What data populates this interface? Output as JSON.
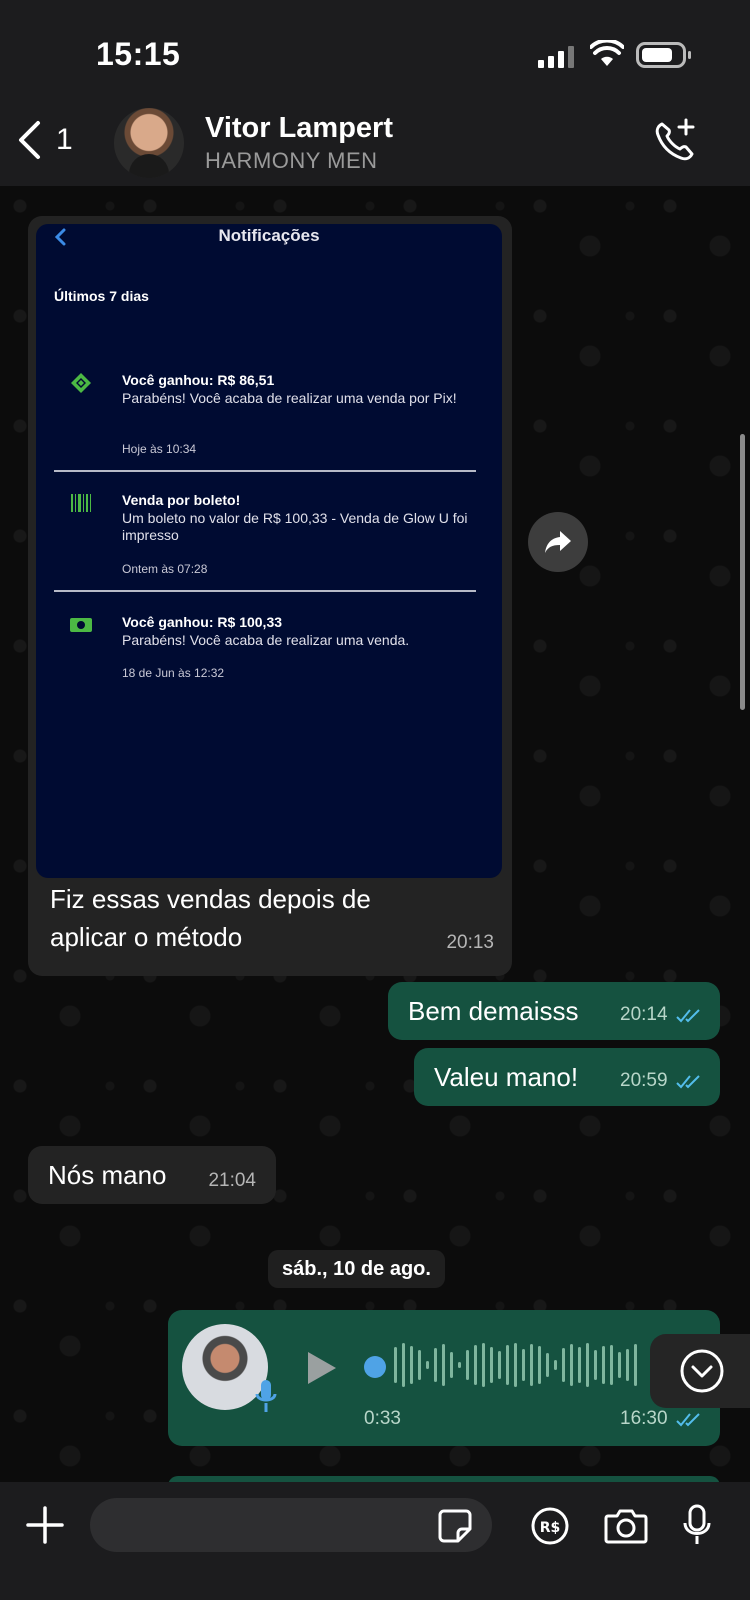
{
  "status_bar": {
    "time": "15:15"
  },
  "header": {
    "back_count": "1",
    "contact_name": "Vitor Lampert",
    "contact_subtitle": "HARMONY MEN"
  },
  "image_message": {
    "screenshot": {
      "title": "Notificações",
      "section": "Últimos 7 dias",
      "notifications": [
        {
          "icon": "pix-diamond-icon",
          "title": "Você ganhou: R$ 86,51",
          "body": "Parabéns! Você acaba de realizar uma venda por Pix!",
          "date": "Hoje às 10:34"
        },
        {
          "icon": "barcode-icon",
          "title": "Venda por boleto!",
          "body": "Um boleto no valor de R$ 100,33 - Venda de Glow U foi impresso",
          "date": "Ontem às 07:28"
        },
        {
          "icon": "cash-icon",
          "title": "Você ganhou: R$ 100,33",
          "body": "Parabéns! Você acaba de realizar uma venda.",
          "date": "18 de Jun às 12:32"
        }
      ]
    },
    "caption": "Fiz essas vendas depois de aplicar o método",
    "time": "20:13"
  },
  "messages": [
    {
      "direction": "out",
      "text": "Bem demaisss",
      "time": "20:14"
    },
    {
      "direction": "out",
      "text": "Valeu mano!",
      "time": "20:59"
    },
    {
      "direction": "in",
      "text": "Nós mano",
      "time": "21:04"
    }
  ],
  "date_separator": "sáb., 10 de ago.",
  "voice_message": {
    "duration": "0:33",
    "time": "16:30"
  },
  "input": {
    "placeholder": ""
  },
  "colors": {
    "outgoing_bubble": "#155240",
    "incoming_bubble": "#232323",
    "read_ticks": "#53bdeb",
    "screenshot_bg": "#000b32"
  }
}
